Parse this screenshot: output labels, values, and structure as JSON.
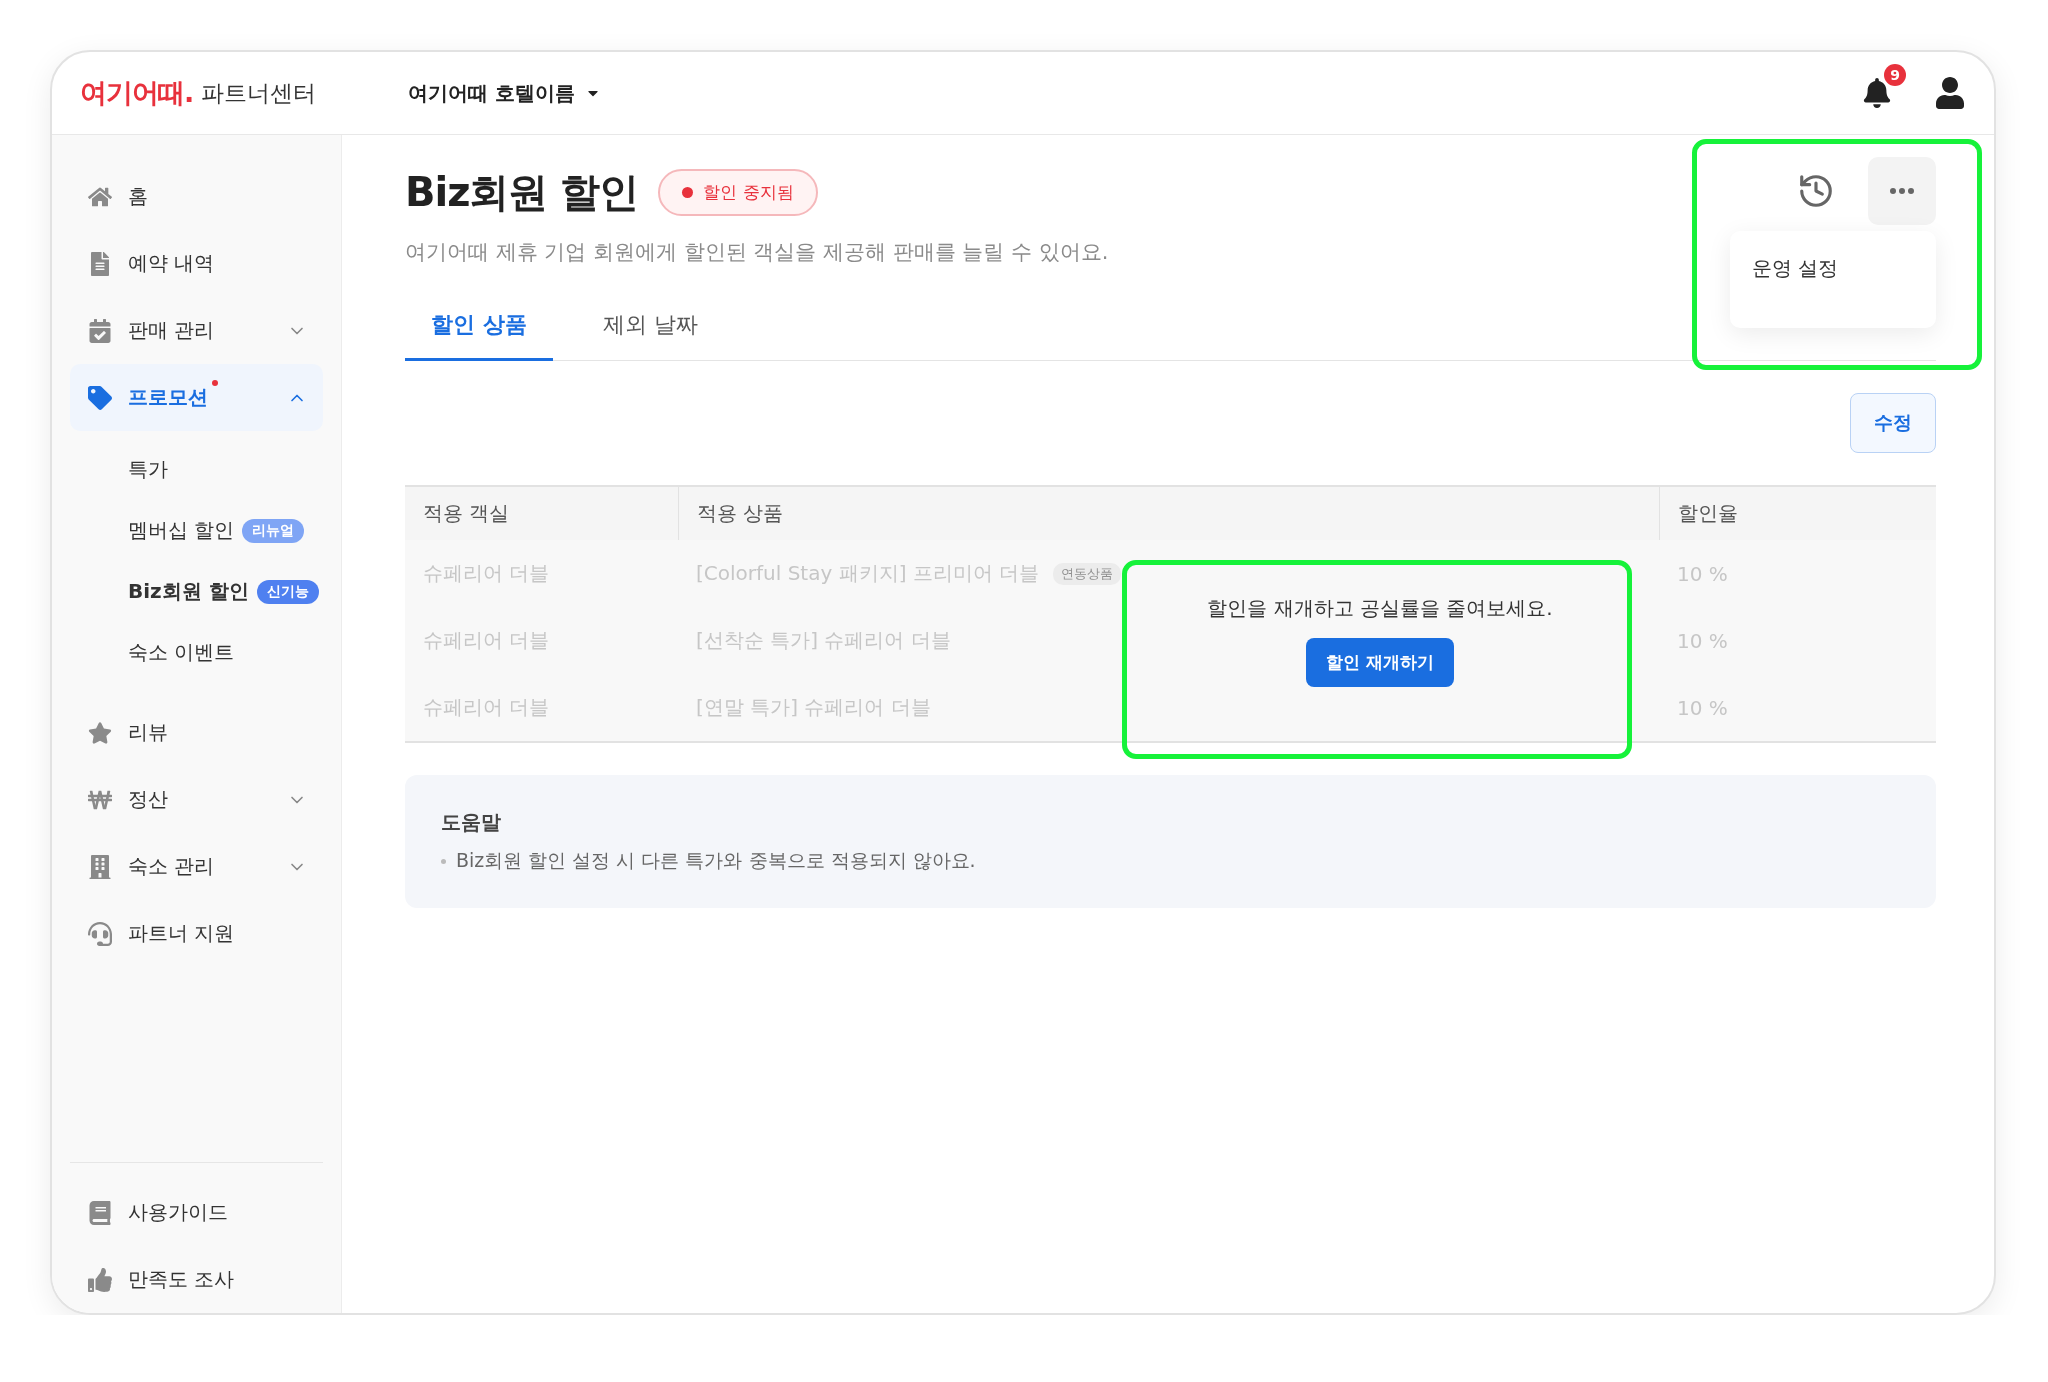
{
  "header": {
    "logo": "여기어때.",
    "logo_subtitle": "파트너센터",
    "property_selector": "여기어때 호텔이름",
    "notification_count": "9"
  },
  "sidebar": {
    "items": [
      {
        "label": "홈",
        "selected": false
      },
      {
        "label": "예약 내역",
        "selected": false
      },
      {
        "label": "판매 관리",
        "selected": false,
        "expanded": false
      },
      {
        "label": "프로모션",
        "selected": true,
        "expanded": true,
        "new_dot": true,
        "children": [
          {
            "label": "특가",
            "selected": false
          },
          {
            "label": "멤버십 할인",
            "selected": false,
            "badge": "리뉴얼",
            "color": "#7fa5f5"
          },
          {
            "label": "Biz회원 할인",
            "selected": true,
            "badge": "신기능",
            "color": "#4f80f0"
          },
          {
            "label": "숙소 이벤트",
            "selected": false
          }
        ]
      },
      {
        "label": "리뷰",
        "selected": false
      },
      {
        "label": "정산",
        "selected": false,
        "expanded": false
      },
      {
        "label": "숙소 관리",
        "selected": false,
        "expanded": false
      },
      {
        "label": "파트너 지원",
        "selected": false
      }
    ],
    "footer_items": [
      {
        "label": "사용가이드"
      },
      {
        "label": "만족도 조사"
      }
    ]
  },
  "page": {
    "title": "Biz회원 할인",
    "status_badge": "할인 중지됨",
    "description": "여기어때 제휴 기업 회원에게 할인된 객실을 제공해 판매를 늘릴 수 있어요.",
    "tabs": [
      {
        "label": "할인 상품",
        "selected": true
      },
      {
        "label": "제외 날짜",
        "selected": false
      }
    ],
    "menu": {
      "items": [
        "운영 설정"
      ]
    },
    "edit_button": "수정",
    "table": {
      "disabled": true,
      "columns": [
        "적용 객실",
        "적용 상품",
        "할인율"
      ],
      "rows": [
        {
          "room": "슈페리어 더블",
          "product": "[Colorful Stay 패키지] 프리미어 더블",
          "tag": "연동상품",
          "rate": "10 %"
        },
        {
          "room": "슈페리어 더블",
          "product": "[선착순 특가] 슈페리어 더블",
          "rate": "10 %"
        },
        {
          "room": "슈페리어 더블",
          "product": "[연말 특가] 슈페리어 더블",
          "rate": "10 %"
        }
      ],
      "overlay": {
        "message": "할인을 재개하고 공실률을 줄여보세요.",
        "button": "할인 재개하기"
      }
    },
    "help": {
      "title": "도움말",
      "items": [
        "Biz회원 할인 설정 시 다른 특가와 중복으로 적용되지 않아요."
      ]
    }
  }
}
